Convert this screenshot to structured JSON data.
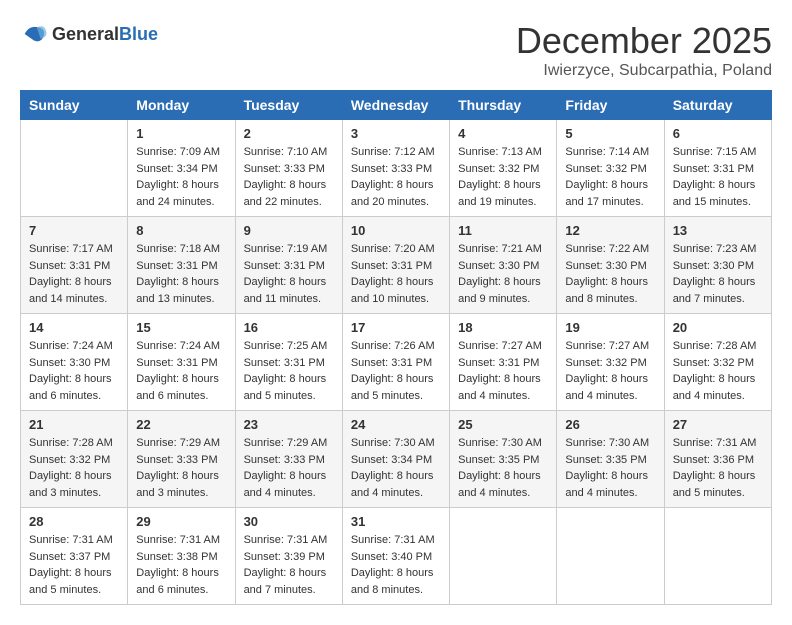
{
  "logo": {
    "general": "General",
    "blue": "Blue"
  },
  "title": {
    "month_year": "December 2025",
    "location": "Iwierzyce, Subcarpathia, Poland"
  },
  "days_of_week": [
    "Sunday",
    "Monday",
    "Tuesday",
    "Wednesday",
    "Thursday",
    "Friday",
    "Saturday"
  ],
  "weeks": [
    [
      {
        "day": "",
        "sunrise": "",
        "sunset": "",
        "daylight": ""
      },
      {
        "day": "1",
        "sunrise": "Sunrise: 7:09 AM",
        "sunset": "Sunset: 3:34 PM",
        "daylight": "Daylight: 8 hours and 24 minutes."
      },
      {
        "day": "2",
        "sunrise": "Sunrise: 7:10 AM",
        "sunset": "Sunset: 3:33 PM",
        "daylight": "Daylight: 8 hours and 22 minutes."
      },
      {
        "day": "3",
        "sunrise": "Sunrise: 7:12 AM",
        "sunset": "Sunset: 3:33 PM",
        "daylight": "Daylight: 8 hours and 20 minutes."
      },
      {
        "day": "4",
        "sunrise": "Sunrise: 7:13 AM",
        "sunset": "Sunset: 3:32 PM",
        "daylight": "Daylight: 8 hours and 19 minutes."
      },
      {
        "day": "5",
        "sunrise": "Sunrise: 7:14 AM",
        "sunset": "Sunset: 3:32 PM",
        "daylight": "Daylight: 8 hours and 17 minutes."
      },
      {
        "day": "6",
        "sunrise": "Sunrise: 7:15 AM",
        "sunset": "Sunset: 3:31 PM",
        "daylight": "Daylight: 8 hours and 15 minutes."
      }
    ],
    [
      {
        "day": "7",
        "sunrise": "Sunrise: 7:17 AM",
        "sunset": "Sunset: 3:31 PM",
        "daylight": "Daylight: 8 hours and 14 minutes."
      },
      {
        "day": "8",
        "sunrise": "Sunrise: 7:18 AM",
        "sunset": "Sunset: 3:31 PM",
        "daylight": "Daylight: 8 hours and 13 minutes."
      },
      {
        "day": "9",
        "sunrise": "Sunrise: 7:19 AM",
        "sunset": "Sunset: 3:31 PM",
        "daylight": "Daylight: 8 hours and 11 minutes."
      },
      {
        "day": "10",
        "sunrise": "Sunrise: 7:20 AM",
        "sunset": "Sunset: 3:31 PM",
        "daylight": "Daylight: 8 hours and 10 minutes."
      },
      {
        "day": "11",
        "sunrise": "Sunrise: 7:21 AM",
        "sunset": "Sunset: 3:30 PM",
        "daylight": "Daylight: 8 hours and 9 minutes."
      },
      {
        "day": "12",
        "sunrise": "Sunrise: 7:22 AM",
        "sunset": "Sunset: 3:30 PM",
        "daylight": "Daylight: 8 hours and 8 minutes."
      },
      {
        "day": "13",
        "sunrise": "Sunrise: 7:23 AM",
        "sunset": "Sunset: 3:30 PM",
        "daylight": "Daylight: 8 hours and 7 minutes."
      }
    ],
    [
      {
        "day": "14",
        "sunrise": "Sunrise: 7:24 AM",
        "sunset": "Sunset: 3:30 PM",
        "daylight": "Daylight: 8 hours and 6 minutes."
      },
      {
        "day": "15",
        "sunrise": "Sunrise: 7:24 AM",
        "sunset": "Sunset: 3:31 PM",
        "daylight": "Daylight: 8 hours and 6 minutes."
      },
      {
        "day": "16",
        "sunrise": "Sunrise: 7:25 AM",
        "sunset": "Sunset: 3:31 PM",
        "daylight": "Daylight: 8 hours and 5 minutes."
      },
      {
        "day": "17",
        "sunrise": "Sunrise: 7:26 AM",
        "sunset": "Sunset: 3:31 PM",
        "daylight": "Daylight: 8 hours and 5 minutes."
      },
      {
        "day": "18",
        "sunrise": "Sunrise: 7:27 AM",
        "sunset": "Sunset: 3:31 PM",
        "daylight": "Daylight: 8 hours and 4 minutes."
      },
      {
        "day": "19",
        "sunrise": "Sunrise: 7:27 AM",
        "sunset": "Sunset: 3:32 PM",
        "daylight": "Daylight: 8 hours and 4 minutes."
      },
      {
        "day": "20",
        "sunrise": "Sunrise: 7:28 AM",
        "sunset": "Sunset: 3:32 PM",
        "daylight": "Daylight: 8 hours and 4 minutes."
      }
    ],
    [
      {
        "day": "21",
        "sunrise": "Sunrise: 7:28 AM",
        "sunset": "Sunset: 3:32 PM",
        "daylight": "Daylight: 8 hours and 3 minutes."
      },
      {
        "day": "22",
        "sunrise": "Sunrise: 7:29 AM",
        "sunset": "Sunset: 3:33 PM",
        "daylight": "Daylight: 8 hours and 3 minutes."
      },
      {
        "day": "23",
        "sunrise": "Sunrise: 7:29 AM",
        "sunset": "Sunset: 3:33 PM",
        "daylight": "Daylight: 8 hours and 4 minutes."
      },
      {
        "day": "24",
        "sunrise": "Sunrise: 7:30 AM",
        "sunset": "Sunset: 3:34 PM",
        "daylight": "Daylight: 8 hours and 4 minutes."
      },
      {
        "day": "25",
        "sunrise": "Sunrise: 7:30 AM",
        "sunset": "Sunset: 3:35 PM",
        "daylight": "Daylight: 8 hours and 4 minutes."
      },
      {
        "day": "26",
        "sunrise": "Sunrise: 7:30 AM",
        "sunset": "Sunset: 3:35 PM",
        "daylight": "Daylight: 8 hours and 4 minutes."
      },
      {
        "day": "27",
        "sunrise": "Sunrise: 7:31 AM",
        "sunset": "Sunset: 3:36 PM",
        "daylight": "Daylight: 8 hours and 5 minutes."
      }
    ],
    [
      {
        "day": "28",
        "sunrise": "Sunrise: 7:31 AM",
        "sunset": "Sunset: 3:37 PM",
        "daylight": "Daylight: 8 hours and 5 minutes."
      },
      {
        "day": "29",
        "sunrise": "Sunrise: 7:31 AM",
        "sunset": "Sunset: 3:38 PM",
        "daylight": "Daylight: 8 hours and 6 minutes."
      },
      {
        "day": "30",
        "sunrise": "Sunrise: 7:31 AM",
        "sunset": "Sunset: 3:39 PM",
        "daylight": "Daylight: 8 hours and 7 minutes."
      },
      {
        "day": "31",
        "sunrise": "Sunrise: 7:31 AM",
        "sunset": "Sunset: 3:40 PM",
        "daylight": "Daylight: 8 hours and 8 minutes."
      },
      {
        "day": "",
        "sunrise": "",
        "sunset": "",
        "daylight": ""
      },
      {
        "day": "",
        "sunrise": "",
        "sunset": "",
        "daylight": ""
      },
      {
        "day": "",
        "sunrise": "",
        "sunset": "",
        "daylight": ""
      }
    ]
  ]
}
